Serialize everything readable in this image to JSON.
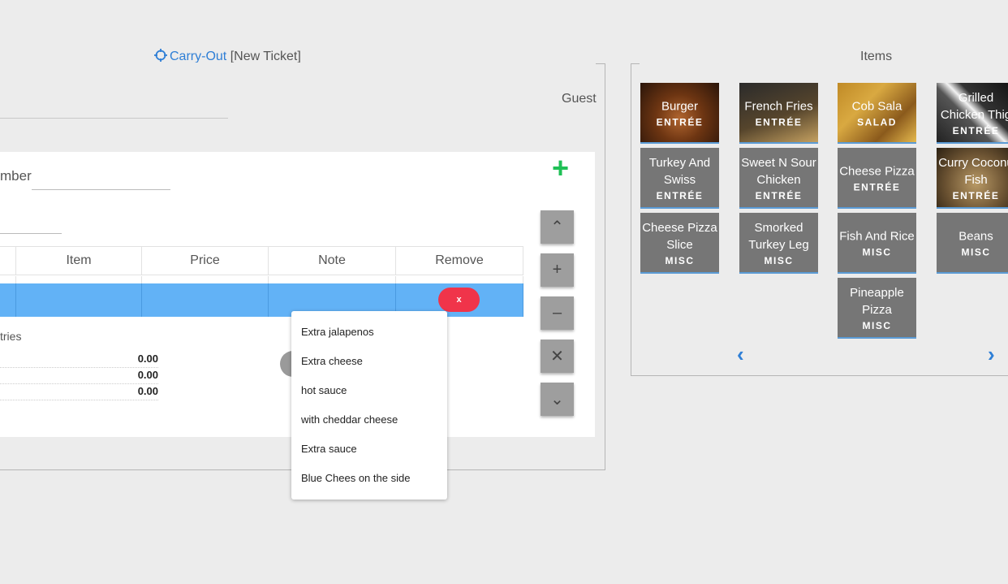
{
  "ticket": {
    "order_type": "Carry-Out",
    "ticket_label": "[New Ticket]",
    "guest_label": "Guest",
    "number_label": "mber",
    "entries_label": "tries"
  },
  "table": {
    "headers": [
      "Item",
      "Price",
      "Note",
      "Remove"
    ],
    "remove_label": "x"
  },
  "totals": [
    "0.00",
    "0.00",
    "0.00"
  ],
  "notes_menu": [
    "Extra jalapenos",
    "Extra cheese",
    "hot sauce",
    "with cheddar cheese",
    "Extra sauce",
    "Blue Chees on the side"
  ],
  "side_buttons": [
    "chevron-up-icon",
    "plus-icon",
    "minus-icon",
    "close-icon",
    "chevron-down-icon"
  ],
  "side_button_glyphs": [
    "⌃",
    "+",
    "–",
    "✕",
    "⌄"
  ],
  "items": {
    "title": "Items",
    "tiles": [
      {
        "name": "Burger",
        "category": "ENTRÉE"
      },
      {
        "name": "French Fries",
        "category": "ENTRÉE"
      },
      {
        "name": "Cob Sala",
        "category": "SALAD"
      },
      {
        "name": "Grilled\nChicken Thig",
        "category": "ENTRÉE"
      },
      {
        "name": "Turkey And\nSwiss",
        "category": "ENTRÉE"
      },
      {
        "name": "Sweet N Sour\nChicken",
        "category": "ENTRÉE"
      },
      {
        "name": "Cheese Pizza",
        "category": "ENTRÉE"
      },
      {
        "name": "Curry Coconu\nFish",
        "category": "ENTRÉE"
      },
      {
        "name": "Cheese Pizza\nSlice",
        "category": "MISC"
      },
      {
        "name": "Smorked\nTurkey Leg",
        "category": "MISC"
      },
      {
        "name": "Fish And Rice",
        "category": "MISC"
      },
      {
        "name": "Beans",
        "category": "MISC"
      },
      {
        "name": "Pineapple\nPizza",
        "category": "MISC"
      }
    ],
    "prev_icon": "‹",
    "next_icon": "›"
  },
  "colors": {
    "accent_blue": "#2f7fd6",
    "selected_row": "#62b2f6",
    "remove_red": "#f0344a",
    "add_green": "#1fc056",
    "tile_grey": "#767676"
  }
}
